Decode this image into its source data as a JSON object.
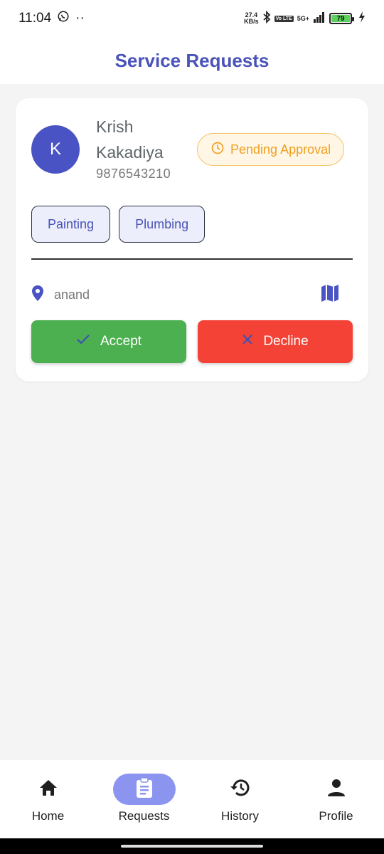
{
  "status_bar": {
    "time": "11:04",
    "dots": "··",
    "net_speed_value": "27.4",
    "net_speed_unit": "KB/s",
    "volte": "Vo LTE",
    "network": "5G+",
    "battery": "79"
  },
  "header": {
    "title": "Service Requests"
  },
  "request": {
    "avatar_initial": "K",
    "customer_name": "Krish Kakadiya",
    "phone": "9876543210",
    "status": "Pending Approval",
    "status_color": "#f0a020",
    "services": [
      "Painting",
      "Plumbing"
    ],
    "location": "anand",
    "accept_label": "Accept",
    "decline_label": "Decline"
  },
  "bottom_nav": {
    "items": [
      {
        "label": "Home",
        "icon": "home-icon"
      },
      {
        "label": "Requests",
        "icon": "clipboard-icon",
        "active": true
      },
      {
        "label": "History",
        "icon": "history-icon"
      },
      {
        "label": "Profile",
        "icon": "person-icon"
      }
    ]
  },
  "colors": {
    "primary": "#4a53b8",
    "accept": "#4caf50",
    "decline": "#f44336",
    "nav_active": "#8b95f0"
  }
}
